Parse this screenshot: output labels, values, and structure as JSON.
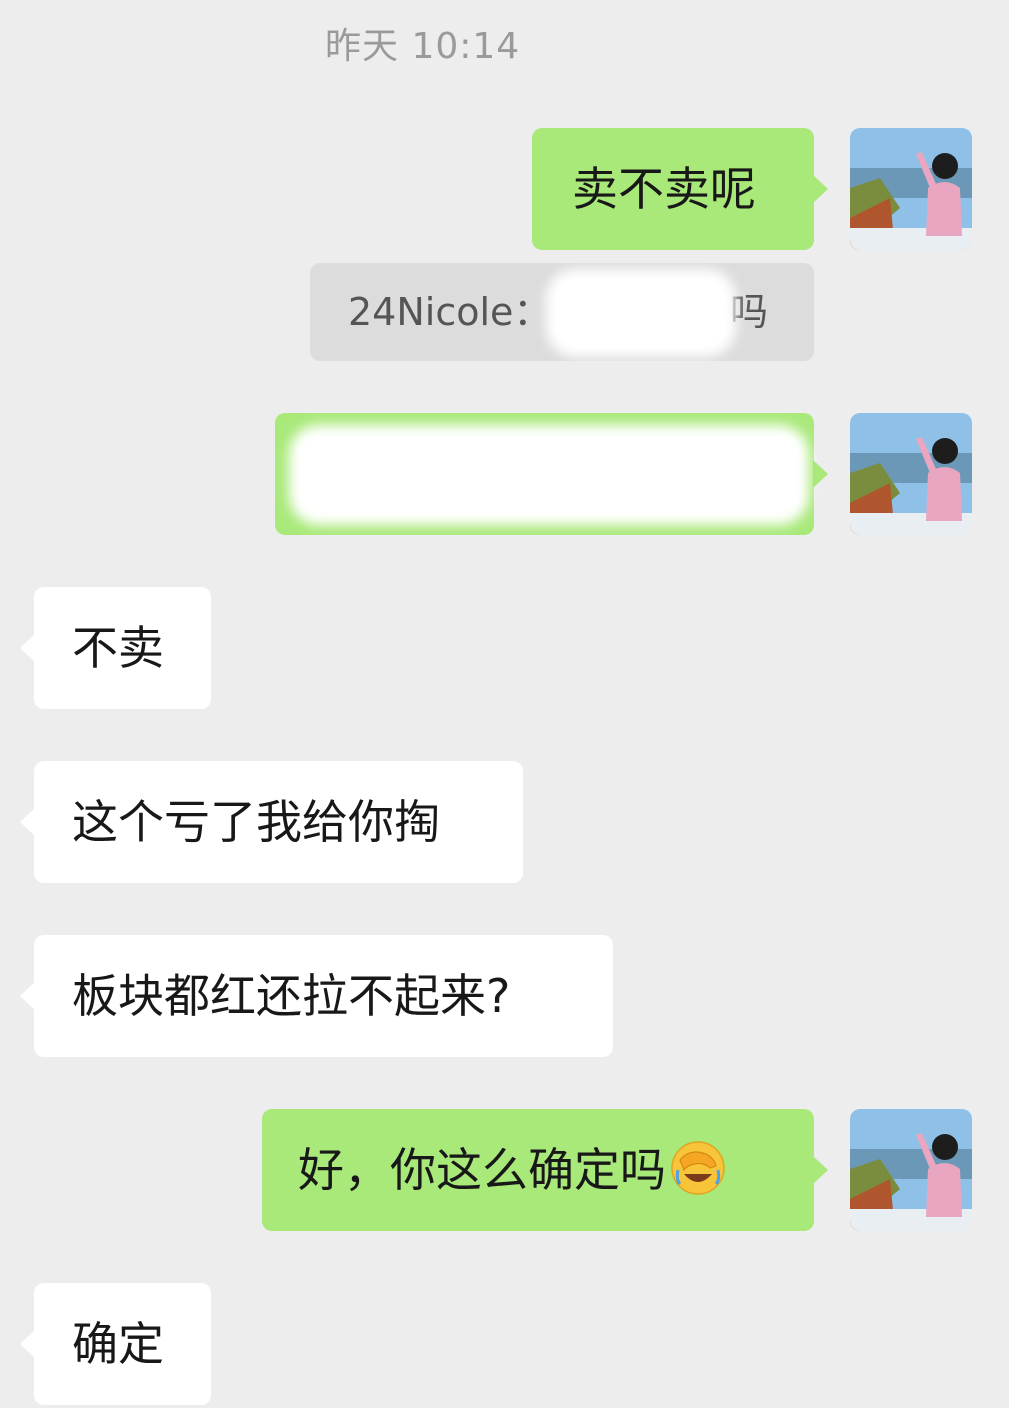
{
  "timestamp": "昨天 10:14",
  "messages": [
    {
      "side": "sent",
      "text": "卖不卖呢"
    },
    {
      "side": "quote",
      "sender": "24Nicole：",
      "visible_tail": "吗"
    },
    {
      "side": "sent",
      "text": ""
    },
    {
      "side": "recv",
      "text": "不卖"
    },
    {
      "side": "recv",
      "text": "这个亏了我给你掏"
    },
    {
      "side": "recv",
      "text": "板块都红还拉不起来?"
    },
    {
      "side": "sent",
      "text": "好，你这么确定吗",
      "emoji": "face-with-hand-over-eyes-laughing-emoji"
    },
    {
      "side": "recv",
      "text": "确定"
    }
  ],
  "colors": {
    "background": "#ededed",
    "sent_bubble": "#a9e97a",
    "recv_bubble": "#ffffff",
    "quote_bg": "#dcdcdc",
    "timestamp": "#9a9a9a"
  }
}
